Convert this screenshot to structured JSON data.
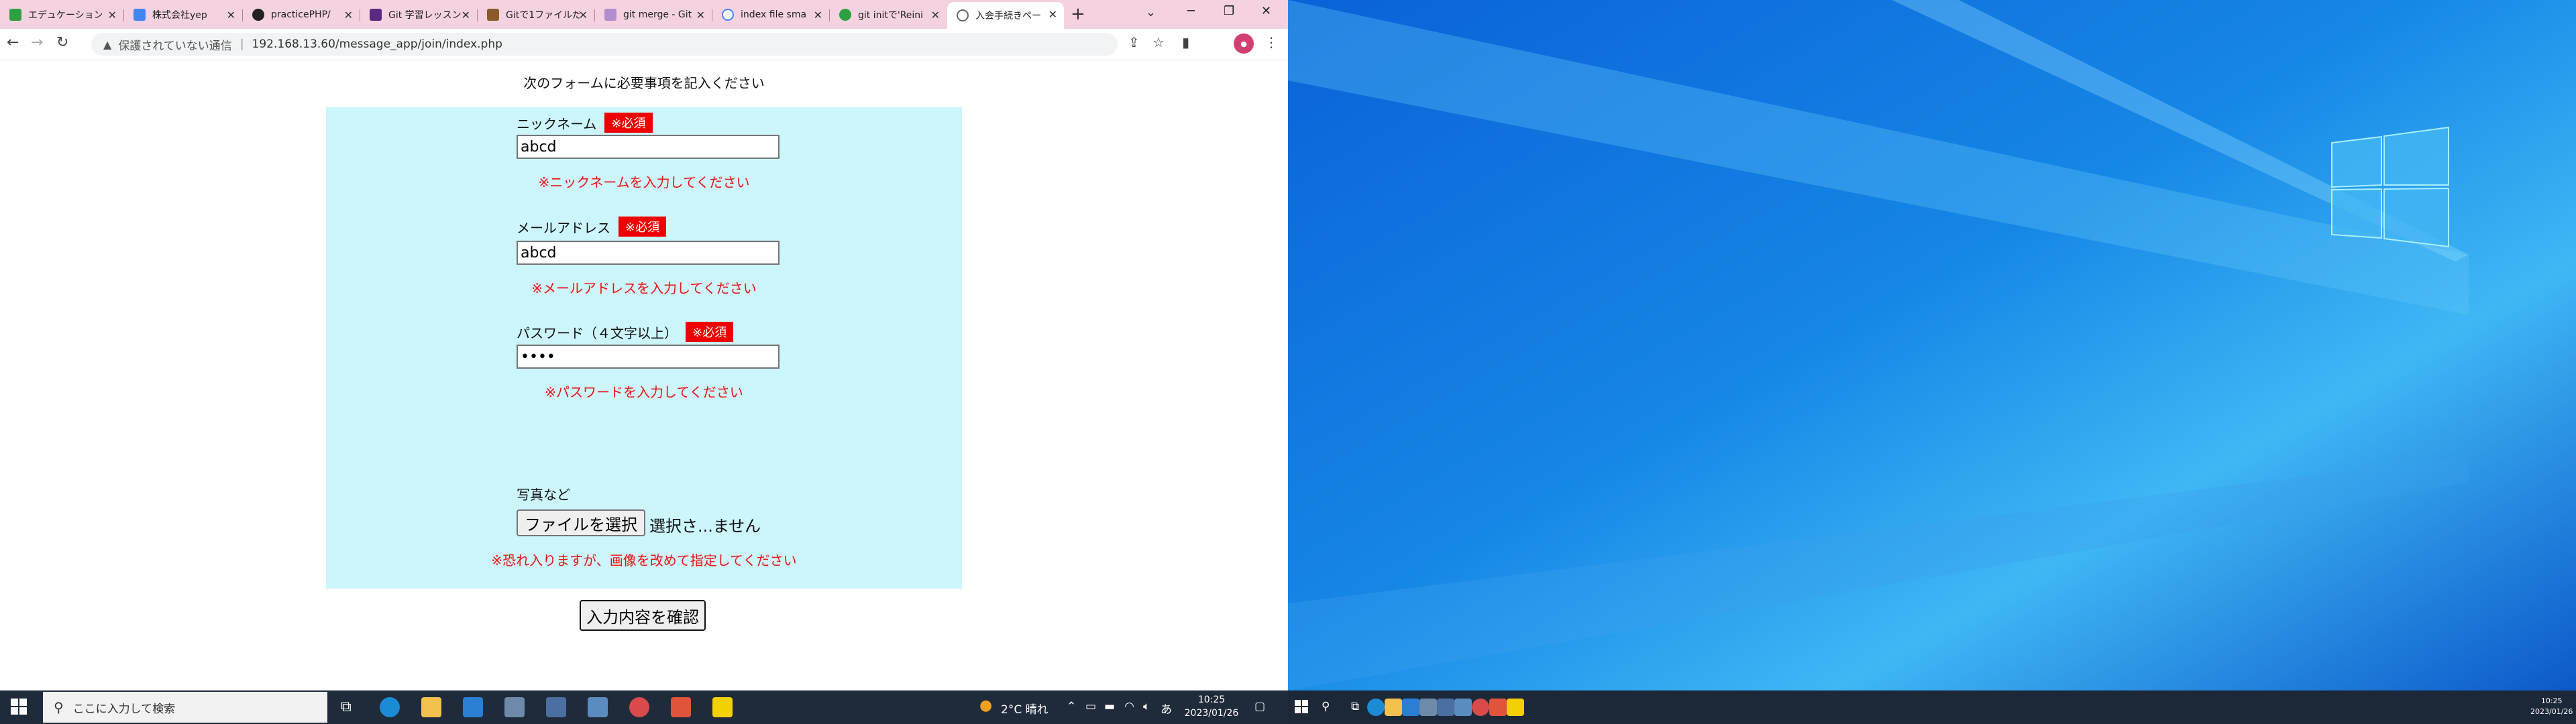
{
  "browser": {
    "tabs": [
      {
        "label": "エデュケーション",
        "fav_color": "#2ea043"
      },
      {
        "label": "株式会社yep",
        "fav_color": "#4285f4"
      },
      {
        "label": "practicePHP/",
        "fav_color": "#222222"
      },
      {
        "label": "Git 学習レッスン",
        "fav_color": "#5a2a82"
      },
      {
        "label": "Gitで1ファイルだ",
        "fav_color": "#8a5a2a"
      },
      {
        "label": "git merge - Git",
        "fav_color": "#b48cd0"
      },
      {
        "label": "index file sma",
        "fav_color": "#4285f4"
      },
      {
        "label": "git initで'Reini",
        "fav_color": "#2ea043"
      },
      {
        "label": "入会手続きペー",
        "fav_color": "#666666",
        "active": true
      }
    ],
    "omnibox": {
      "secure_label": "保護されていない通信",
      "url": "192.168.13.60/message_app/join/index.php"
    }
  },
  "page": {
    "intro": "次のフォームに必要事項を記入ください",
    "nickname": {
      "label": "ニックネーム",
      "required": "※必須",
      "value": "abcd",
      "error": "※ニックネームを入力してください"
    },
    "email": {
      "label": "メールアドレス",
      "required": "※必須",
      "value": "abcd",
      "error": "※メールアドレスを入力してください"
    },
    "password": {
      "label": "パスワード（４文字以上）",
      "required": "※必須",
      "value": "••••",
      "error": "※パスワードを入力してください"
    },
    "photo": {
      "label": "写真など",
      "button": "ファイルを選択",
      "filename": "選択さ...ません",
      "error": "※恐れ入りますが、画像を改めて指定してください"
    },
    "submit": "入力内容を確認"
  },
  "taskbar": {
    "search_placeholder": "ここに入力して検索",
    "weather": "2°C 晴れ",
    "ime": "あ",
    "time": "10:25",
    "date": "2023/01/26",
    "right_time": "10:25",
    "right_date": "2023/01/26"
  }
}
